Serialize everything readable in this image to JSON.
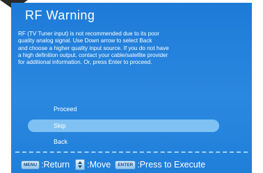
{
  "dialog": {
    "title": "RF Warning",
    "message": "RF (TV Tuner input) is not recommended due to its poor\nquality analog signal. Use Down arrow to select Back\nand choose a higher quality input source. If you do not have\na high definition output, contact your cable/satellite provider\nfor additional information. Or, press Enter to proceed.",
    "options": [
      {
        "label": "Proceed",
        "selected": false
      },
      {
        "label": "Skip",
        "selected": true
      },
      {
        "label": "Back",
        "selected": false
      }
    ]
  },
  "footer": {
    "menu_key": "MENU",
    "menu_action": ":Return",
    "move_icon": "up-down-arrows-icon",
    "move_action": ":Move",
    "enter_key": "ENTER",
    "enter_action": ":Press to Execute"
  },
  "colors": {
    "panel": "#1f7fd9",
    "highlight": "#7fc1f2",
    "text": "#ffffff"
  }
}
